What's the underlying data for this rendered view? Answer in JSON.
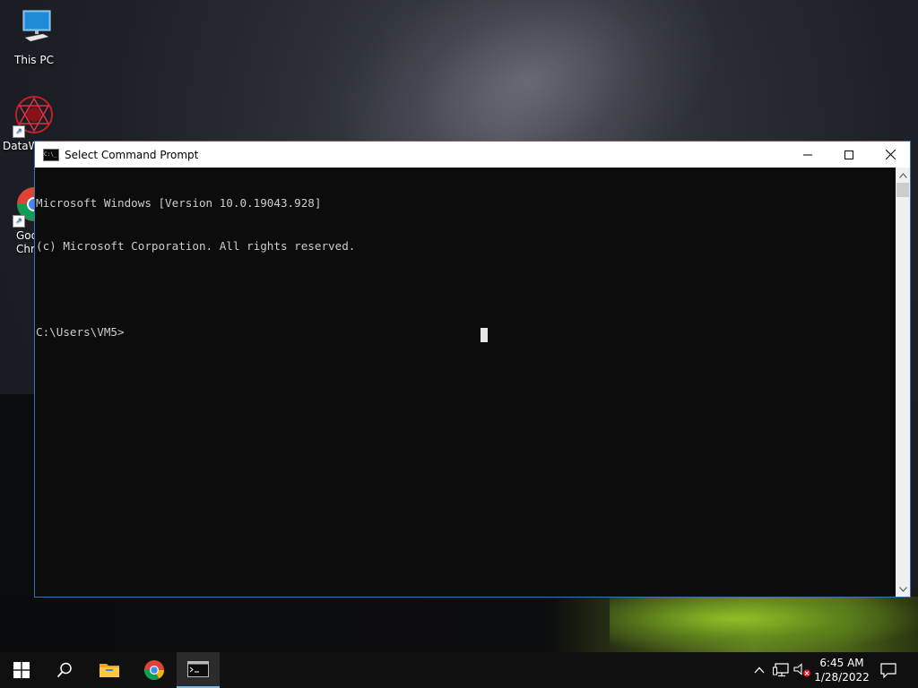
{
  "desktop": {
    "icons": [
      {
        "label": "This PC",
        "icon": "this-pc-icon"
      },
      {
        "label": "DataW",
        "icon": "datawrapper-app-icon"
      },
      {
        "label": "Goo Chro",
        "icon": "google-chrome-icon"
      }
    ]
  },
  "window": {
    "title": "Select Command Prompt",
    "app_icon": "command-prompt-icon",
    "controls": {
      "minimize": "–",
      "maximize": "☐",
      "close": "✕"
    },
    "console_lines": [
      "Microsoft Windows [Version 10.0.19043.928]",
      "(c) Microsoft Corporation. All rights reserved.",
      "",
      "C:\\Users\\VM5>"
    ]
  },
  "taskbar": {
    "items": [
      {
        "name": "start-button",
        "icon": "windows-logo-icon"
      },
      {
        "name": "search-button",
        "icon": "search-icon"
      },
      {
        "name": "file-explorer-button",
        "icon": "folder-icon"
      },
      {
        "name": "chrome-button",
        "icon": "google-chrome-icon"
      },
      {
        "name": "command-prompt-button",
        "icon": "command-prompt-icon",
        "active": true
      }
    ],
    "tray": {
      "icons": [
        "chevron-up-icon",
        "network-icon",
        "volume-muted-icon"
      ],
      "time": "6:45 AM",
      "date": "1/28/2022",
      "notification_icon": "notification-icon"
    }
  },
  "colors": {
    "console_bg": "#0c0c0c",
    "console_text": "#cccccc",
    "taskbar_bg": "#101010",
    "accent": "#76b9ed"
  }
}
